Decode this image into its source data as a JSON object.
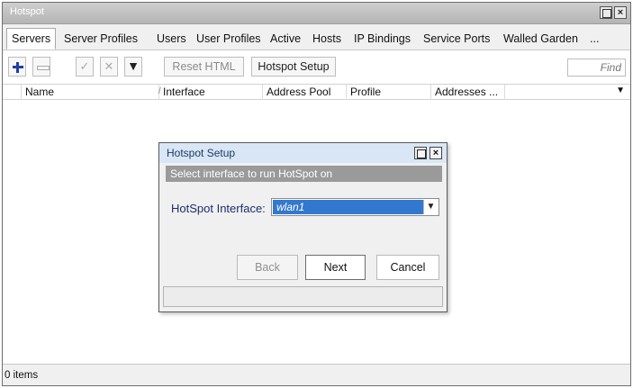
{
  "window": {
    "title": "Hotspot",
    "restore_label": "",
    "close_label": "×"
  },
  "tabs": [
    {
      "label": "Servers"
    },
    {
      "label": "Server Profiles"
    },
    {
      "label": "Users"
    },
    {
      "label": "User Profiles"
    },
    {
      "label": "Active"
    },
    {
      "label": "Hosts"
    },
    {
      "label": "IP Bindings"
    },
    {
      "label": "Service Ports"
    },
    {
      "label": "Walled Garden"
    },
    {
      "label": "..."
    }
  ],
  "toolbar": {
    "check_glyph": "✓",
    "cross_glyph": "✕",
    "filter_glyph": "▼",
    "reset_html_label": "Reset HTML",
    "hotspot_setup_label": "Hotspot Setup",
    "find_placeholder": "Find"
  },
  "columns": {
    "name": "Name",
    "sort_glyph": "/",
    "interface": "Interface",
    "address_pool": "Address Pool",
    "profile": "Profile",
    "addresses": "Addresses ...",
    "menu_glyph": "▼"
  },
  "status": {
    "items": "0 items"
  },
  "dialog": {
    "title": "Hotspot Setup",
    "close_label": "×",
    "subtitle": "Select interface to run HotSpot on",
    "field_label": "HotSpot Interface:",
    "field_value": "wlan1",
    "dropdown_glyph": "▼",
    "back_label": "Back",
    "next_label": "Next",
    "cancel_label": "Cancel"
  },
  "colors": {
    "accent_blue": "#1f3ea8",
    "selection_blue": "#3378cf",
    "subtitle_gray": "#9a9a9a",
    "dialog_title_bg": "#d9e6f5"
  }
}
